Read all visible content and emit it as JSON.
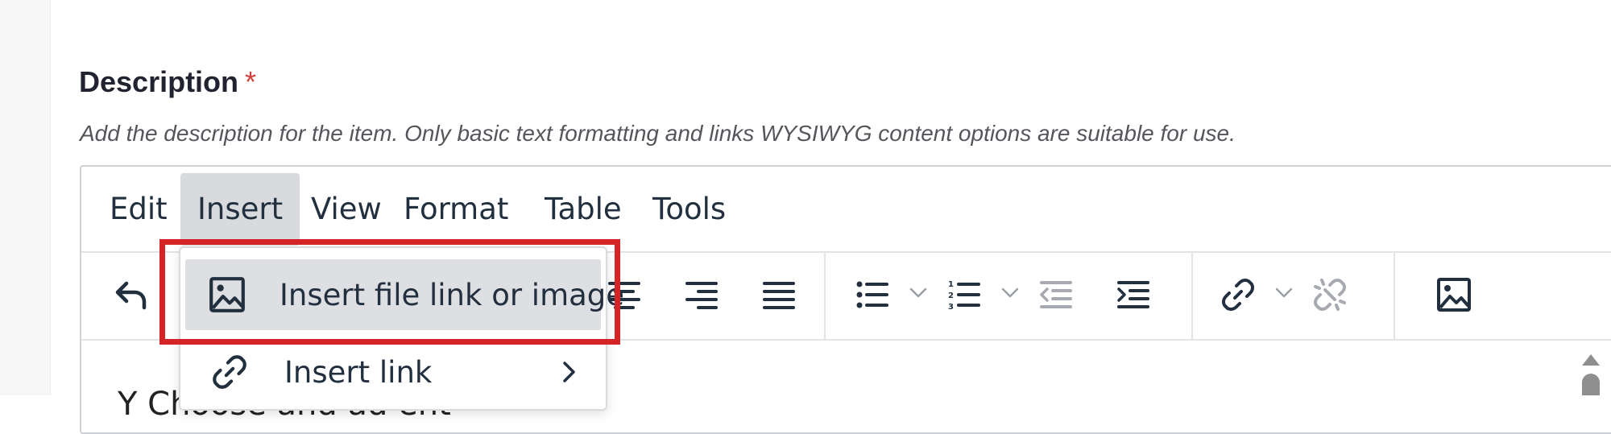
{
  "field": {
    "label": "Description",
    "required_marker": "*",
    "help_text": "Add the description for the item. Only basic text formatting and links WYSIWYG content options are suitable for use."
  },
  "menubar": {
    "items": [
      {
        "label": "Edit"
      },
      {
        "label": "Insert"
      },
      {
        "label": "View"
      },
      {
        "label": "Format"
      },
      {
        "label": "Table"
      },
      {
        "label": "Tools"
      }
    ],
    "active": "Insert"
  },
  "insert_menu": {
    "items": [
      {
        "label": "Insert file link or image",
        "icon": "image-icon",
        "highlighted": true
      },
      {
        "label": "Insert link",
        "icon": "link-icon",
        "has_submenu": true
      }
    ]
  },
  "toolbar": {
    "buttons": [
      "undo-icon",
      "align-center-icon",
      "align-right-icon",
      "align-justify-icon",
      "bullet-list-icon",
      "numbered-list-icon",
      "outdent-icon",
      "indent-icon",
      "link-icon",
      "unlink-icon",
      "image-icon"
    ]
  },
  "content": {
    "visible_text_partial": "Y                          Choose and ad                  ent"
  },
  "colors": {
    "required": "#d0413a",
    "highlight_box": "#d42426",
    "menu_active_bg": "#d8dadd"
  }
}
